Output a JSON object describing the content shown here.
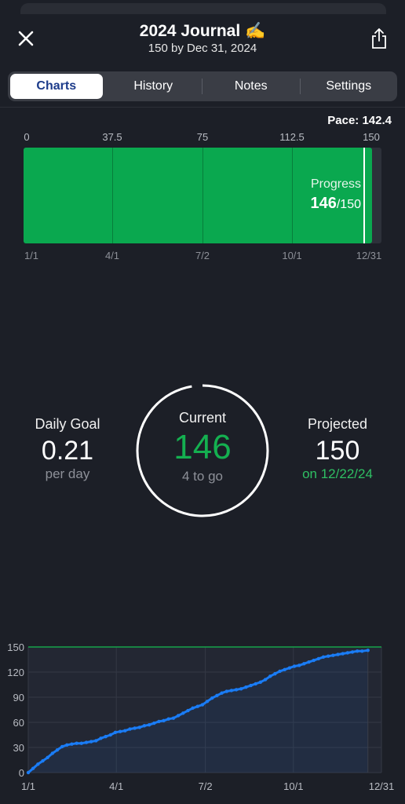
{
  "header": {
    "title": "2024 Journal ✍️",
    "subtitle": "150 by Dec 31, 2024",
    "close_icon": "close-icon",
    "share_icon": "share-icon"
  },
  "tabs": [
    {
      "label": "Charts",
      "active": true
    },
    {
      "label": "History",
      "active": false
    },
    {
      "label": "Notes",
      "active": false
    },
    {
      "label": "Settings",
      "active": false
    }
  ],
  "progress": {
    "pace_label": "Pace: 142.4",
    "scale_ticks": [
      "0",
      "37.5",
      "75",
      "112.5",
      "150"
    ],
    "date_ticks": [
      "1/1",
      "4/1",
      "7/2",
      "10/1",
      "12/31"
    ],
    "label": "Progress",
    "value": "146",
    "total": "/150",
    "fill_fraction": 0.9733,
    "pace_fraction": 0.9493,
    "fill_color": "#0aa84f"
  },
  "stats": {
    "daily_goal_label": "Daily Goal",
    "daily_goal_value": "0.21",
    "daily_goal_unit": "per day",
    "current_label": "Current",
    "current_value": "146",
    "current_sub": "4 to go",
    "current_fraction": 0.9733,
    "projected_label": "Projected",
    "projected_value": "150",
    "projected_sub": "on 12/22/24",
    "accent_green": "#14b050"
  },
  "chart_data": {
    "type": "line",
    "ylim": [
      0,
      150
    ],
    "yticks": [
      "0",
      "30",
      "60",
      "90",
      "120",
      "150"
    ],
    "xticks": [
      "1/1",
      "4/1",
      "7/2",
      "10/1",
      "12/31"
    ],
    "goal_line": 150,
    "series": [
      {
        "color": "#1a7cf5",
        "x": [
          0,
          5,
          10,
          15,
          20,
          25,
          30,
          35,
          40,
          45,
          50,
          55,
          60,
          65,
          70,
          75,
          80,
          85,
          90,
          95,
          100,
          105,
          110,
          115,
          120,
          125,
          130,
          135,
          140,
          145,
          150,
          155,
          160,
          165,
          170,
          175,
          180,
          185,
          190,
          195,
          200,
          205,
          210,
          215,
          220,
          225,
          230,
          235,
          240,
          245,
          250,
          255,
          260,
          265,
          270,
          275,
          280,
          285,
          290,
          295,
          300,
          305,
          310,
          315,
          320,
          325,
          330,
          335,
          340,
          345,
          351
        ],
        "y": [
          0,
          5,
          10,
          14,
          18,
          23,
          27,
          31,
          33,
          34,
          35,
          35,
          36,
          37,
          38,
          41,
          43,
          45,
          48,
          49,
          50,
          52,
          53,
          54,
          56,
          57,
          59,
          61,
          62,
          64,
          65,
          68,
          71,
          74,
          77,
          79,
          81,
          85,
          89,
          92,
          95,
          97,
          98,
          99,
          100,
          102,
          104,
          106,
          108,
          111,
          115,
          118,
          121,
          123,
          125,
          127,
          128,
          130,
          132,
          134,
          136,
          138,
          139,
          140,
          141,
          142,
          143,
          144,
          145,
          145,
          146
        ]
      }
    ]
  }
}
